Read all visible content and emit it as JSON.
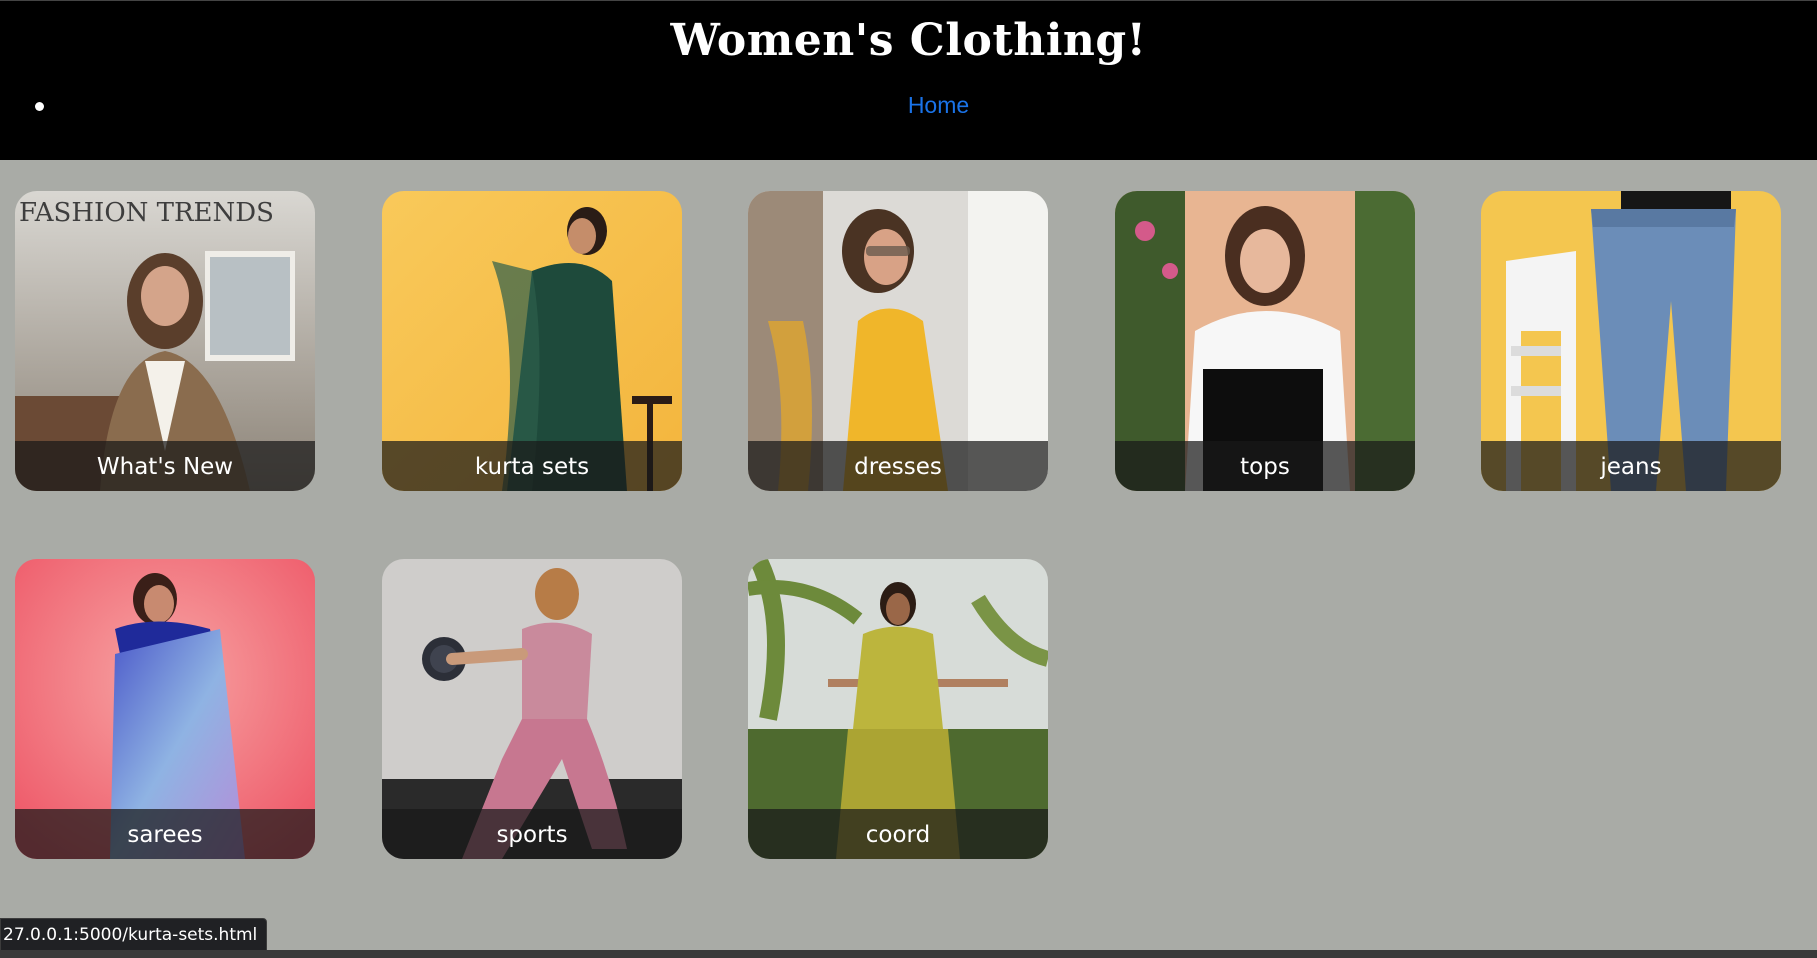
{
  "header": {
    "title": "Women's Clothing!",
    "nav": {
      "home_label": "Home"
    }
  },
  "categories": [
    {
      "label": "What's New",
      "scene": "fashion-trends"
    },
    {
      "label": "kurta sets",
      "scene": "kurta"
    },
    {
      "label": "dresses",
      "scene": "yellow-dress"
    },
    {
      "label": "tops",
      "scene": "black-white-top"
    },
    {
      "label": "jeans",
      "scene": "denim"
    },
    {
      "label": "sarees",
      "scene": "blue-saree"
    },
    {
      "label": "sports",
      "scene": "pink-activewear"
    },
    {
      "label": "coord",
      "scene": "olive-coord"
    }
  ],
  "status_bar": {
    "url": "27.0.0.1:5000/kurta-sets.html"
  },
  "colors": {
    "page_bg": "#a9aba6",
    "header_bg": "#000000",
    "link": "#1a73e8"
  }
}
